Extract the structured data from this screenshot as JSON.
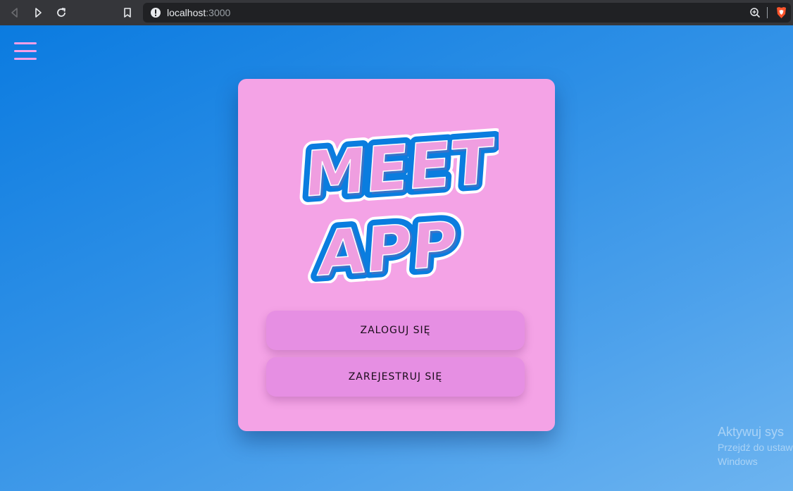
{
  "browser": {
    "url_host": "localhost",
    "url_port": ":3000",
    "icons": [
      "back-icon",
      "forward-icon",
      "reload-icon",
      "bookmark-icon",
      "site-info-icon",
      "zoom-icon",
      "brave-shield-icon"
    ]
  },
  "app": {
    "menu_icon": "hamburger-menu-icon",
    "logo_line1": "MEET",
    "logo_line2": "APP",
    "login_label": "ZALOGUJ SIĘ",
    "register_label": "ZAREJESTRUJ SIĘ"
  },
  "colors": {
    "page_gradient_start": "#0b7be0",
    "page_gradient_end": "#6db4f0",
    "card_bg": "#f4a3e6",
    "button_bg": "#e68fe3",
    "logo_fill": "#ef9ee0",
    "logo_outline": "#0a7ddf",
    "menu_icon": "#f59fe7"
  },
  "watermark": {
    "line1": "Aktywuj sys",
    "line2": "Przejdź do ustaw",
    "line3": "Windows"
  }
}
